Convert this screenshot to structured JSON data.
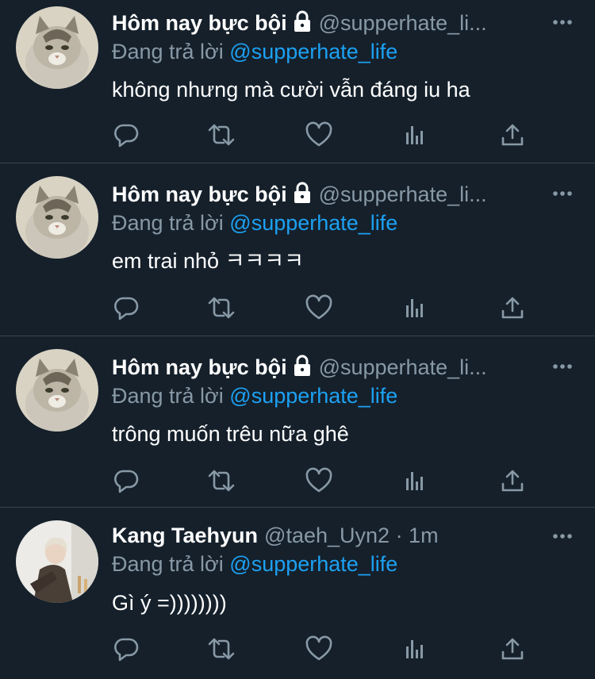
{
  "colors": {
    "background": "#15202b",
    "divider": "#38444d",
    "secondary_text": "#8899a6",
    "mention": "#1da1f2",
    "primary_text": "#ffffff"
  },
  "icons": [
    "lock-icon",
    "more-icon",
    "reply-icon",
    "retweet-icon",
    "like-icon",
    "analytics-icon",
    "share-icon"
  ],
  "tweets": [
    {
      "avatar": "cat",
      "name": "Hôm nay bực bội",
      "locked": true,
      "handle": "@supperhate_li...",
      "time": "",
      "reply_prefix": "Đang trả lời",
      "reply_mention": "@supperhate_life",
      "text": "không nhưng mà cười vẫn đáng iu ha"
    },
    {
      "avatar": "cat",
      "name": "Hôm nay bực bội",
      "locked": true,
      "handle": "@supperhate_li...",
      "time": "",
      "reply_prefix": "Đang trả lời",
      "reply_mention": "@supperhate_life",
      "text": "em trai nhỏ ㅋㅋㅋㅋ"
    },
    {
      "avatar": "cat",
      "name": "Hôm nay bực bội",
      "locked": true,
      "handle": "@supperhate_li...",
      "time": "",
      "reply_prefix": "Đang trả lời",
      "reply_mention": "@supperhate_life",
      "text": "trông muốn trêu nữa ghê"
    },
    {
      "avatar": "person",
      "name": "Kang Taehyun",
      "locked": false,
      "handle": "@taeh_Uyn2",
      "time": "· 1m",
      "reply_prefix": "Đang trả lời",
      "reply_mention": "@supperhate_life",
      "text": "Gì ý =))))))))"
    }
  ]
}
